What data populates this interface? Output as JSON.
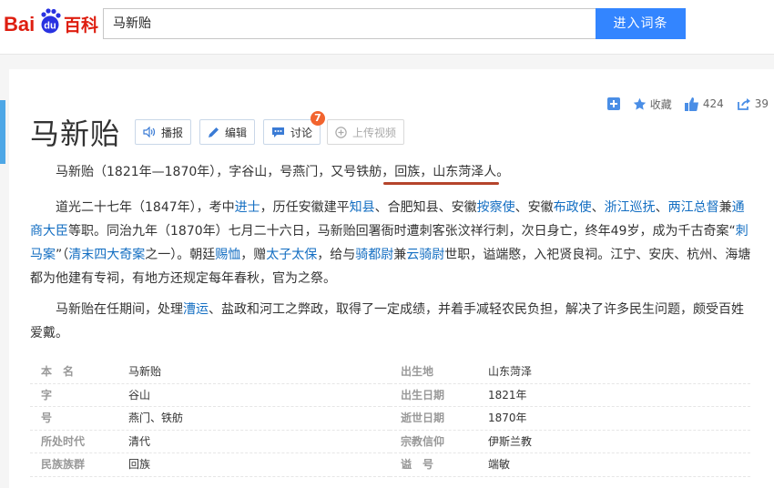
{
  "header": {
    "search_value": "马新贻",
    "search_button": "进入词条",
    "logo_text_1": "Bai",
    "logo_text_2": "du",
    "logo_text_3": "百科"
  },
  "actions": {
    "collect_label": "收藏",
    "like_count": "424",
    "share_count": "39"
  },
  "title": "马新贻",
  "buttons": {
    "play": "播报",
    "edit": "编辑",
    "discuss": "讨论",
    "discuss_badge": "7",
    "upload_video": "上传视频"
  },
  "paragraphs": {
    "p1": "马新贻（1821年—1870年），字谷山，号燕门，又号铁舫，回族，山东菏泽人。",
    "p2": [
      {
        "t": "道光二十七年（1847年），考中",
        "link": false
      },
      {
        "t": "进士",
        "link": true
      },
      {
        "t": "，历任安徽建平",
        "link": false
      },
      {
        "t": "知县",
        "link": true
      },
      {
        "t": "、合肥知县、安徽",
        "link": false
      },
      {
        "t": "按察使",
        "link": true
      },
      {
        "t": "、安徽",
        "link": false
      },
      {
        "t": "布政使",
        "link": true
      },
      {
        "t": "、",
        "link": false
      },
      {
        "t": "浙江巡抚",
        "link": true
      },
      {
        "t": "、",
        "link": false
      },
      {
        "t": "两江总督",
        "link": true
      },
      {
        "t": "兼",
        "link": false
      },
      {
        "t": "通商大臣",
        "link": true
      },
      {
        "t": "等职。同治九年（1870年）七月二十六日，马新贻回署衙时遭刺客张汶祥行刺，次日身亡，终年49岁，成为千古奇案“",
        "link": false
      },
      {
        "t": "刺马案",
        "link": true
      },
      {
        "t": "”（",
        "link": false
      },
      {
        "t": "清末四大奇案",
        "link": true
      },
      {
        "t": "之一）。朝廷",
        "link": false
      },
      {
        "t": "赐恤",
        "link": true
      },
      {
        "t": "，赠",
        "link": false
      },
      {
        "t": "太子太保",
        "link": true
      },
      {
        "t": "，给与",
        "link": false
      },
      {
        "t": "骑都尉",
        "link": true
      },
      {
        "t": "兼",
        "link": false
      },
      {
        "t": "云骑尉",
        "link": true
      },
      {
        "t": "世职，谥端愍，入祀贤良祠。江宁、安庆、杭州、海塘都为他建有专祠，有地方还规定每年春秋，官为之祭。",
        "link": false
      }
    ],
    "p3": [
      {
        "t": "马新贻在任期间，处理",
        "link": false
      },
      {
        "t": "漕运",
        "link": true
      },
      {
        "t": "、盐政和河工之弊政，取得了一定成绩，并着手减轻农民负担，解决了许多民生问题，颇受百姓爱戴。",
        "link": false
      }
    ]
  },
  "info_left": [
    {
      "k": "本　名",
      "v": "马新贻"
    },
    {
      "k": "字",
      "v": "谷山"
    },
    {
      "k": "号",
      "v": "燕门、铁舫"
    },
    {
      "k": "所处时代",
      "v": "清代"
    },
    {
      "k": "民族族群",
      "v": "回族"
    }
  ],
  "info_right": [
    {
      "k": "出生地",
      "v": "山东菏泽"
    },
    {
      "k": "出生日期",
      "v": "1821年"
    },
    {
      "k": "逝世日期",
      "v": "1870年"
    },
    {
      "k": "宗教信仰",
      "v": "伊斯兰教"
    },
    {
      "k": "谥　号",
      "v": "端敏"
    }
  ],
  "colors": {
    "link": "#136ec2",
    "search_button": "#3385ff",
    "badge": "#f2642f",
    "logo_red": "#de1e10",
    "logo_blue": "#2932e1"
  }
}
